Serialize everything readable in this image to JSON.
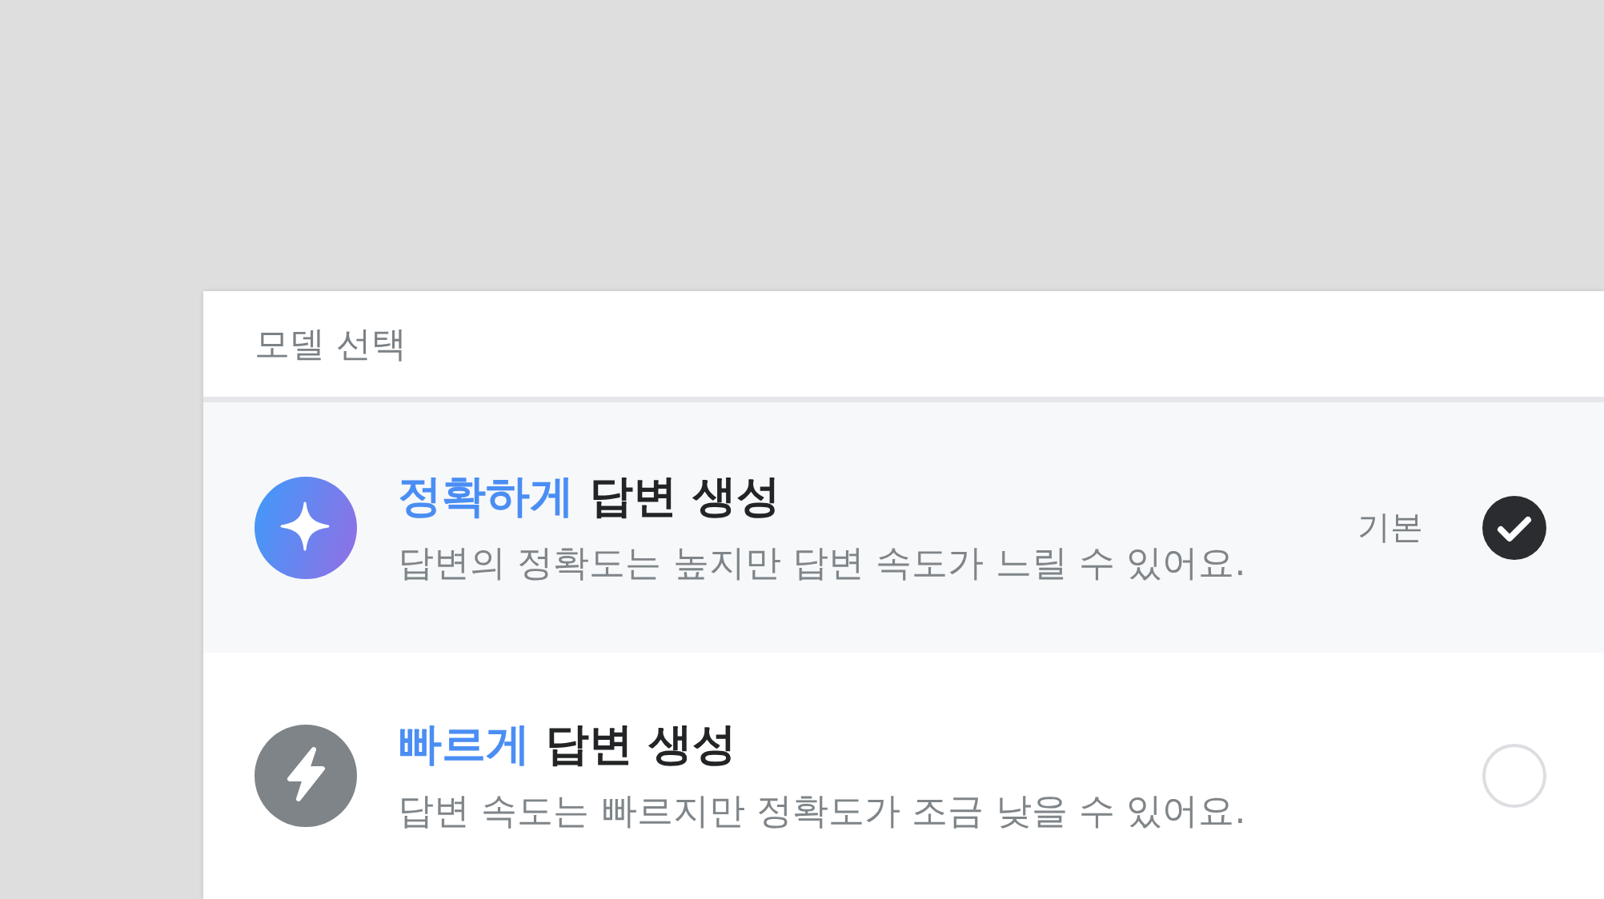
{
  "header": {
    "title": "모델 선택"
  },
  "options": [
    {
      "kind": "accurate",
      "title_accent": "정확하게",
      "title": "답변 생성",
      "description": "답변의 정확도는 높지만 답변 속도가 느릴 수 있어요.",
      "badge": "기본",
      "selected": true
    },
    {
      "kind": "fast",
      "title_accent": "빠르게",
      "title": "답변 생성",
      "description": "답변 속도는 빠르지만 정확도가 조금 낮을 수 있어요.",
      "selected": false
    }
  ]
}
